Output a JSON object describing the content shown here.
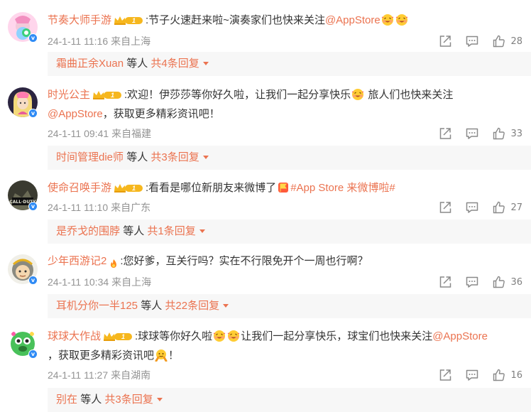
{
  "colors": {
    "accent": "#eb7350",
    "meta_gray": "#939393",
    "reply_bg": "#f7f7f7",
    "verified_blue": "#2f8bf5",
    "level_gold": "#f6b71e"
  },
  "comments": [
    {
      "user": "节奏大师手游",
      "level": "1",
      "text_before": ":节子火速赶来啦~演奏家们也快来关注",
      "mention": "@AppStore",
      "date": "24-1-11 11:16",
      "source": "来自上海",
      "likes": "28",
      "reply_user": "霜曲正余Xuan",
      "reply_mid": "等人",
      "reply_count": "共4条回复"
    },
    {
      "user": "时光公主",
      "level": "1",
      "text_before": ":欢迎！伊莎莎等你好久啦，让我们一起分享快乐",
      "text_after": "旅人们也快来关注",
      "mention": "@AppStore",
      "text_end": "，获取更多精彩资讯吧！",
      "date": "24-1-11 09:41",
      "source": "来自福建",
      "likes": "33",
      "reply_user": "时间管理die师",
      "reply_mid": "等人",
      "reply_count": "共3条回复"
    },
    {
      "user": "使命召唤手游",
      "level": "1",
      "text_before": ":看看是哪位新朋友来微博了",
      "topic": "#App Store 来微博啦#",
      "date": "24-1-11 11:10",
      "source": "来自广东",
      "likes": "27",
      "reply_user": "是乔戈的围脖",
      "reply_mid": "等人",
      "reply_count": "共1条回复"
    },
    {
      "user": "少年西游记2",
      "text_before": ":您好爹，互关行吗？实在不行限免开个一周也行啊？",
      "date": "24-1-11 10:34",
      "source": "来自上海",
      "likes": "36",
      "reply_user": "耳机分你一半125",
      "reply_mid": "等人",
      "reply_count": "共22条回复"
    },
    {
      "user": "球球大作战",
      "level": "1",
      "text_before": ":球球等你好久啦",
      "text_after": "让我们一起分享快乐，球宝们也快来关注",
      "mention": "@AppStore",
      "text_end": "，获取更多精彩资讯吧",
      "text_tail": "！",
      "date": "24-1-11 11:27",
      "source": "来自湖南",
      "likes": "16",
      "reply_user": "别在",
      "reply_mid": "等人",
      "reply_count": "共3条回复"
    }
  ],
  "icons": {
    "share": "share-icon",
    "comment": "comment-icon",
    "like": "thumbs-up-icon",
    "verified": "verified-v-icon",
    "level": "crown-level-icon",
    "caret": "caret-down-icon"
  }
}
